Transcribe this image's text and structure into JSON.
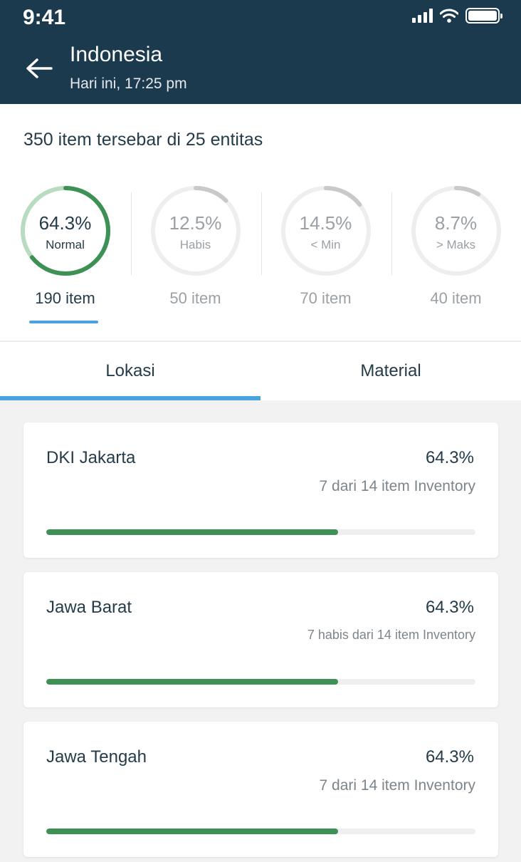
{
  "status_bar": {
    "time": "9:41"
  },
  "header": {
    "title": "Indonesia",
    "subtitle": "Hari ini, 17:25 pm"
  },
  "summary": {
    "text": "350 item tersebar di 25 entitas",
    "stats": [
      {
        "percent": "64.3%",
        "label": "Normal",
        "count": "190 item",
        "value": 0.643,
        "active": true
      },
      {
        "percent": "12.5%",
        "label": "Habis",
        "count": "50 item",
        "value": 0.125,
        "active": false
      },
      {
        "percent": "14.5%",
        "label": "< Min",
        "count": "70 item",
        "value": 0.145,
        "active": false
      },
      {
        "percent": "8.7%",
        "label": "> Maks",
        "count": "40 item",
        "value": 0.087,
        "active": false
      }
    ]
  },
  "tabs": [
    {
      "label": "Lokasi",
      "active": true
    },
    {
      "label": "Material",
      "active": false
    }
  ],
  "locations": [
    {
      "name": "DKI Jakarta",
      "percent": "64.3%",
      "detail": "7 dari 14 item Inventory",
      "progress": 0.68
    },
    {
      "name": "Jawa Barat",
      "percent": "64.3%",
      "detail": "7 habis dari 14 item Inventory",
      "progress": 0.68
    },
    {
      "name": "Jawa Tengah",
      "percent": "64.3%",
      "detail": "7 dari 14 item Inventory",
      "progress": 0.68
    }
  ],
  "colors": {
    "header_bg": "#1c3a4e",
    "accent_blue": "#4aa3df",
    "progress_green": "#3e9155",
    "ring_light_green": "#b9dcc0",
    "ring_grey": "#eeeeee",
    "ring_grey_arc": "#c9c9c9"
  }
}
